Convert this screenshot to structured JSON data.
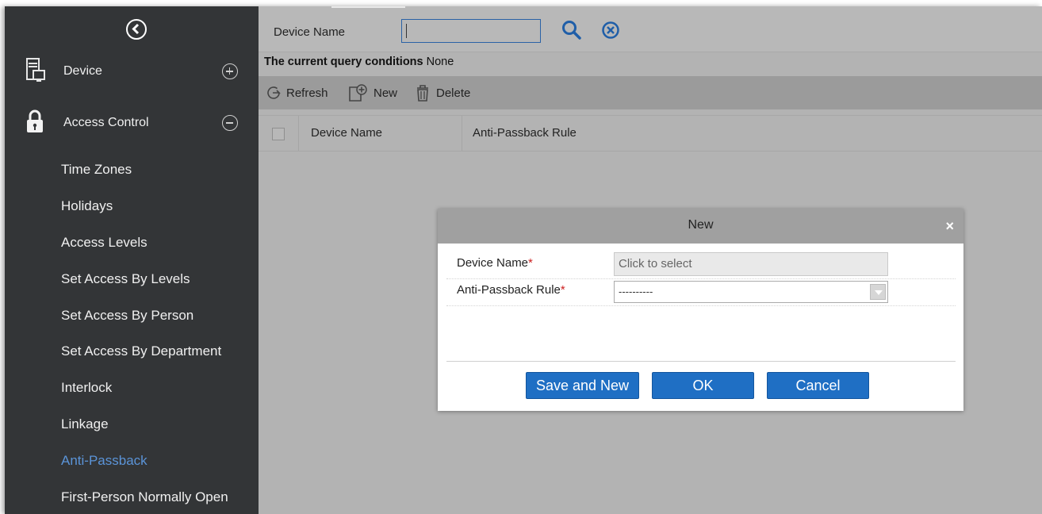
{
  "sidebar": {
    "groups": [
      {
        "label": "Device",
        "icon": "device-icon",
        "state": "collapsed"
      },
      {
        "label": "Access Control",
        "icon": "lock-icon",
        "state": "expanded"
      }
    ],
    "items": [
      {
        "label": "Time Zones"
      },
      {
        "label": "Holidays"
      },
      {
        "label": "Access Levels"
      },
      {
        "label": "Set Access By Levels"
      },
      {
        "label": "Set Access By Person"
      },
      {
        "label": "Set Access By Department"
      },
      {
        "label": "Interlock"
      },
      {
        "label": "Linkage"
      },
      {
        "label": "Anti-Passback",
        "active": true
      },
      {
        "label": "First-Person Normally Open"
      }
    ],
    "active_color": "#5b94d8"
  },
  "search": {
    "label": "Device Name",
    "value": ""
  },
  "query": {
    "prefix": "The current query conditions",
    "value": "None"
  },
  "toolbar": {
    "refresh": "Refresh",
    "new": "New",
    "delete": "Delete"
  },
  "grid": {
    "columns": [
      "Device Name",
      "Anti-Passback Rule"
    ]
  },
  "dialog": {
    "title": "New",
    "close": "×",
    "fields": [
      {
        "label": "Device Name",
        "required": "*",
        "placeholder": "Click to select"
      },
      {
        "label": "Anti-Passback Rule",
        "required": "*",
        "value": "----------"
      }
    ],
    "buttons": {
      "save_new": "Save and New",
      "ok": "OK",
      "cancel": "Cancel"
    },
    "button_color": "#1f6fc4"
  }
}
